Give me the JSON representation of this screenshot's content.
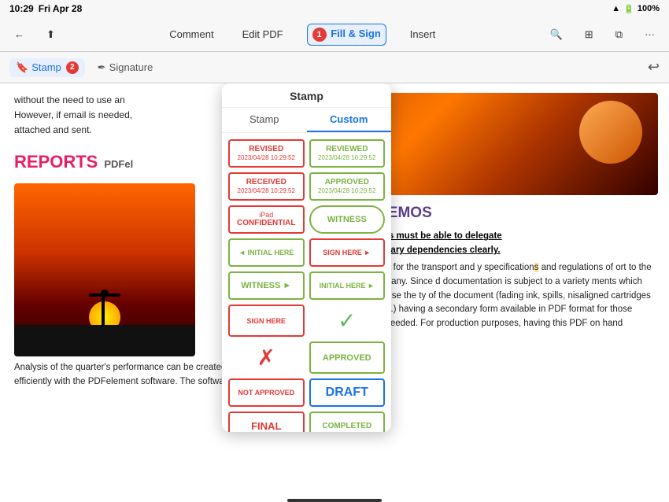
{
  "statusBar": {
    "time": "10:29",
    "day": "Fri Apr 28",
    "wifi": "WiFi",
    "battery": "100%"
  },
  "toolbar": {
    "backLabel": "←",
    "shareLabel": "⬆",
    "commentLabel": "Comment",
    "editPdfLabel": "Edit PDF",
    "fillSignLabel": "Fill & Sign",
    "insertLabel": "Insert",
    "searchLabel": "🔍",
    "gridLabel": "⊞",
    "windowLabel": "⧉",
    "moreLabel": "···",
    "badge1": "1",
    "badge2": "2"
  },
  "secondaryToolbar": {
    "stampLabel": "Stamp",
    "signatureLabel": "Signature"
  },
  "stampPopup": {
    "title": "Stamp",
    "tabs": [
      {
        "label": "Stamp",
        "active": false
      },
      {
        "label": "Custom",
        "active": true
      }
    ],
    "stamps": [
      {
        "id": "revised",
        "name": "REVISED",
        "date": "2023/04/28 10:29:52",
        "style": "red-border"
      },
      {
        "id": "reviewed",
        "name": "REVIEWED",
        "date": "2023/04/28 10:29:52",
        "style": "green-border"
      },
      {
        "id": "received",
        "name": "RECEIVED",
        "date": "2023/04/28 10:29:52",
        "style": "red-border"
      },
      {
        "id": "approved-date",
        "name": "APPROVED",
        "date": "2023/04/28 10:29:52",
        "style": "green-border"
      },
      {
        "id": "ipad-confidential",
        "label1": "iPad",
        "label2": "CONFIDENTIAL",
        "style": "red-border-box"
      },
      {
        "id": "witness-ellipse",
        "name": "WITNESS",
        "style": "green-ellipse"
      },
      {
        "id": "initial-here-left",
        "name": "INITIAL HERE",
        "style": "green-arrow-left"
      },
      {
        "id": "sign-here-right",
        "name": "SIGN HERE",
        "style": "red-arrow-right"
      },
      {
        "id": "witness-arrow",
        "name": "WITNESS",
        "style": "green-arrow-right"
      },
      {
        "id": "initial-here-right",
        "name": "INITIAL HERE",
        "style": "green-arrow-right"
      },
      {
        "id": "sign-here-rect",
        "name": "SIGN HERE",
        "style": "red-rect"
      },
      {
        "id": "checkmark",
        "symbol": "✓",
        "style": "green-check"
      },
      {
        "id": "xmark",
        "symbol": "✗",
        "style": "red-x"
      },
      {
        "id": "approved-outline",
        "name": "APPROVED",
        "style": "green-outline"
      },
      {
        "id": "not-approved",
        "name": "NOT APPROVED",
        "style": "red-outline"
      },
      {
        "id": "draft",
        "name": "DRAFT",
        "style": "blue-outline"
      },
      {
        "id": "final",
        "name": "FINAL",
        "style": "red-outline"
      },
      {
        "id": "completed",
        "name": "COMPLETED",
        "style": "green-outline"
      }
    ]
  },
  "pdfLeft": {
    "text1": "without the need to use an",
    "text2": "However, if email is needed,",
    "text3": "attached and sent.",
    "heading1": "REPORTS",
    "headingSub": "PDFel",
    "bodyText": "Analysis of the quarter's performance can be created quickly and efficiently with the PDFelement software. The software allows"
  },
  "pdfRight": {
    "headingText": "ATION MEMOS",
    "para1": "l Gas industries must be able to delegate to their subsidiary dependencies clearly.",
    "para2": "s especially true for the transport and y specifications and regulations of ort to the subsidiary company. Since d documentation is subject to a variety ments which would compromise the ty of the document (fading ink, spills, nisaligned cartridges in the printer etc.) having a secondary form available in PDF format for those subsidiaries is needed. For production purposes, having this PDF on hand"
  }
}
